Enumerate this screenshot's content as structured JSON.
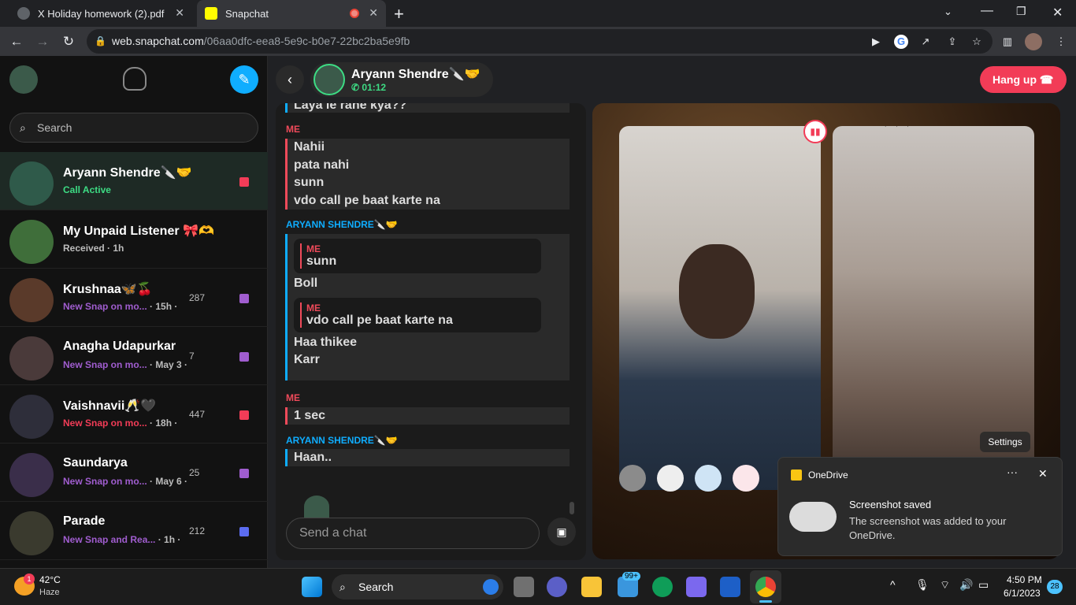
{
  "browser": {
    "tabs": [
      {
        "title": "X Holiday homework (2).pdf",
        "active": false
      },
      {
        "title": "Snapchat",
        "active": true
      }
    ],
    "url_domain": "web.snapchat.com",
    "url_path": "/06aa0dfc-eea8-5e9c-b0e7-22bc2ba5e9fb"
  },
  "sidebar": {
    "search_placeholder": "Search",
    "conversations": [
      {
        "name": "Aryann Shendre🔪🤝",
        "status": "Call Active",
        "status_color": "#3ddc84",
        "meta": "",
        "streak": "",
        "selected": true,
        "indicator": "#f23c57"
      },
      {
        "name": "My Unpaid Listener 🎀🫶",
        "status": "Received",
        "meta": "· 1h",
        "streak": "",
        "status_color": "#bdbdbd",
        "selected": false,
        "indicator": ""
      },
      {
        "name": "Krushnaa🦋🍒",
        "status": "New Snap on mo...",
        "meta": "· 15h ·",
        "streak": "287",
        "status_color": "#a05dcf",
        "selected": false,
        "indicator": "#a05dcf"
      },
      {
        "name": "Anagha Udapurkar",
        "status": "New Snap on mo...",
        "meta": "· May 3 ·",
        "streak": "7",
        "status_color": "#a05dcf",
        "selected": false,
        "indicator": "#a05dcf"
      },
      {
        "name": "Vaishnavii🥂🖤",
        "status": "New Snap on mo...",
        "meta": "· 18h ·",
        "streak": "447",
        "status_color": "#f23c57",
        "selected": false,
        "indicator": "#f23c57"
      },
      {
        "name": "Saundarya",
        "status": "New Snap on mo...",
        "meta": "· May 6 ·",
        "streak": "25",
        "status_color": "#a05dcf",
        "selected": false,
        "indicator": "#a05dcf"
      },
      {
        "name": "Parade",
        "status": "New Snap and Rea...",
        "meta": "· 1h ·",
        "streak": "212",
        "status_color": "#a05dcf",
        "selected": false,
        "indicator": "#5b6cf0"
      }
    ]
  },
  "chat_header": {
    "name": "Aryann Shendre🔪🤝",
    "call_timer": "01:12",
    "hangup_label": "Hang up"
  },
  "messages": {
    "top_partial": "Laya le rahe kya??",
    "me_label": "ME",
    "friend_label": "ARYANN SHENDRE🔪🤝",
    "block1": [
      "Nahii",
      "pata nahi",
      "sunn",
      "vdo call pe baat karte na"
    ],
    "quote1_sender": "ME",
    "quote1_text": "sunn",
    "reply1": "Boll",
    "quote2_sender": "ME",
    "quote2_text": "vdo call pe baat karte na",
    "reply2": [
      "Haa thikee",
      "Karr"
    ],
    "block2": "1 sec",
    "reply3": "Haan..",
    "input_placeholder": "Send a chat"
  },
  "video": {
    "settings_label": "Settings"
  },
  "toast": {
    "app": "OneDrive",
    "title": "Screenshot saved",
    "body": "The screenshot was added to your OneDrive."
  },
  "taskbar": {
    "weather_temp": "42°C",
    "weather_desc": "Haze",
    "weather_badge": "1",
    "search_label": "Search",
    "mail_badge": "99+",
    "time": "4:50 PM",
    "date": "6/1/2023",
    "notif_count": "28"
  }
}
